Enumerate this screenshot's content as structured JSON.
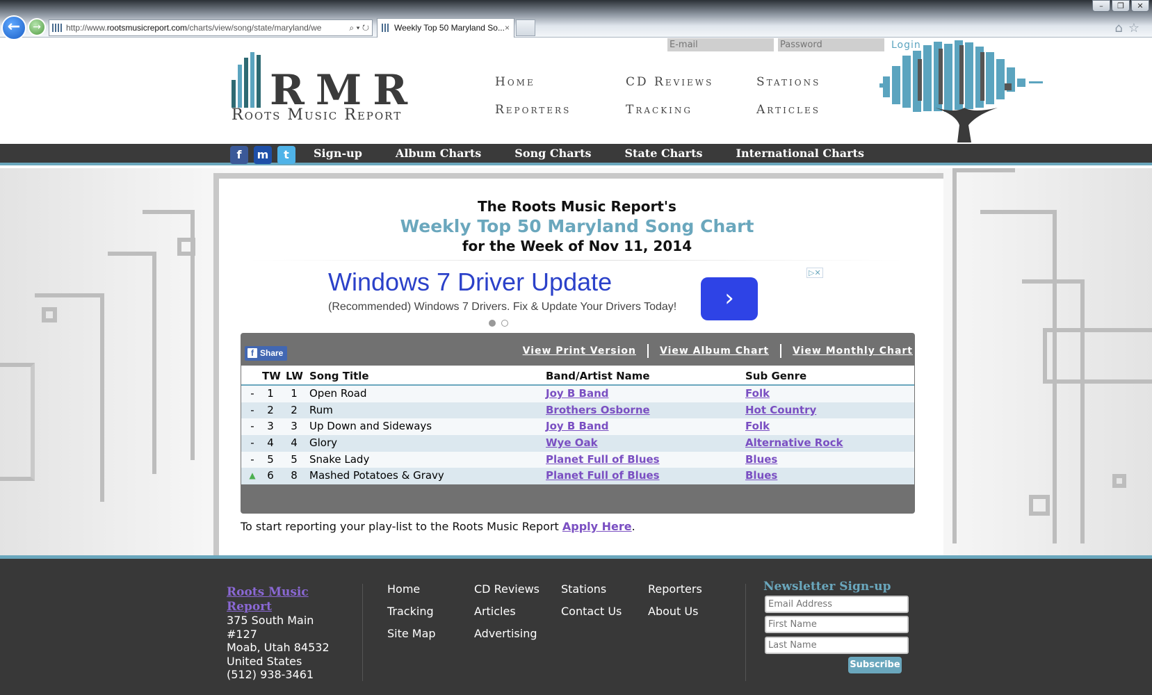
{
  "browser": {
    "url_prefix": "http://www.",
    "url_domain": "rootsmusicreport.com",
    "url_rest": "/charts/view/song/state/maryland/we",
    "tab_title": "Weekly Top 50 Maryland So...",
    "tab_close": "×"
  },
  "login": {
    "email_placeholder": "E-mail",
    "password_placeholder": "Password",
    "login_label": "Login"
  },
  "logo": {
    "big": "RMR",
    "sub": "Roots Music Report"
  },
  "topnav": [
    "Home",
    "CD Reviews",
    "Stations",
    "Reporters",
    "Tracking",
    "Articles"
  ],
  "navbar": {
    "social": [
      "f",
      "m",
      "t"
    ],
    "links": [
      "Sign-up",
      "Album Charts",
      "Song Charts",
      "State Charts",
      "International Charts"
    ]
  },
  "chart_header": {
    "line1": "The Roots Music Report's",
    "line2": "Weekly Top 50 Maryland Song Chart",
    "line3": "for the Week of Nov 11, 2014"
  },
  "ad": {
    "title": "Windows 7 Driver Update",
    "desc": "(Recommended) Windows 7 Drivers. Fix & Update Your Drivers Today!",
    "arrow": "›",
    "choices": "▷✕"
  },
  "panel": {
    "share": "Share",
    "links": [
      "View Print Version",
      "View Album Chart",
      "View Monthly Chart"
    ]
  },
  "table": {
    "headers": {
      "tw": "TW",
      "lw": "LW",
      "song": "Song Title",
      "artist": "Band/Artist Name",
      "genre": "Sub Genre"
    },
    "rows": [
      {
        "move": "-",
        "tw": "1",
        "lw": "1",
        "song": "Open Road",
        "artist": "Joy B Band",
        "genre": "Folk"
      },
      {
        "move": "-",
        "tw": "2",
        "lw": "2",
        "song": "Rum",
        "artist": "Brothers Osborne",
        "genre": "Hot Country"
      },
      {
        "move": "-",
        "tw": "3",
        "lw": "3",
        "song": "Up Down and Sideways",
        "artist": "Joy B Band",
        "genre": "Folk"
      },
      {
        "move": "-",
        "tw": "4",
        "lw": "4",
        "song": "Glory",
        "artist": "Wye Oak",
        "genre": "Alternative Rock"
      },
      {
        "move": "-",
        "tw": "5",
        "lw": "5",
        "song": "Snake Lady",
        "artist": "Planet Full of Blues",
        "genre": "Blues"
      },
      {
        "move": "▲",
        "tw": "6",
        "lw": "8",
        "song": "Mashed Potatoes & Gravy",
        "artist": "Planet Full of Blues",
        "genre": "Blues"
      }
    ]
  },
  "apply": {
    "text": "To start reporting your play-list to the Roots Music Report ",
    "link": "Apply Here",
    "end": "."
  },
  "footer": {
    "org_link_1": "Roots Music",
    "org_link_2": "Report",
    "address": [
      "375 South Main",
      "#127",
      "Moab, Utah 84532",
      "United States",
      "(512) 938-3461"
    ],
    "nav": [
      "Home",
      "CD Reviews",
      "Stations",
      "Reporters",
      "Tracking",
      "Articles",
      "Contact Us",
      "About Us",
      "Site Map",
      "Advertising"
    ],
    "newsletter_title": "Newsletter Sign-up",
    "email_ph": "Email Address",
    "first_ph": "First Name",
    "last_ph": "Last Name",
    "subscribe": "Subscribe"
  },
  "colors": {
    "accent": "#6aa7bd",
    "dark": "#3a3a3a",
    "link": "#7a4fc2"
  }
}
